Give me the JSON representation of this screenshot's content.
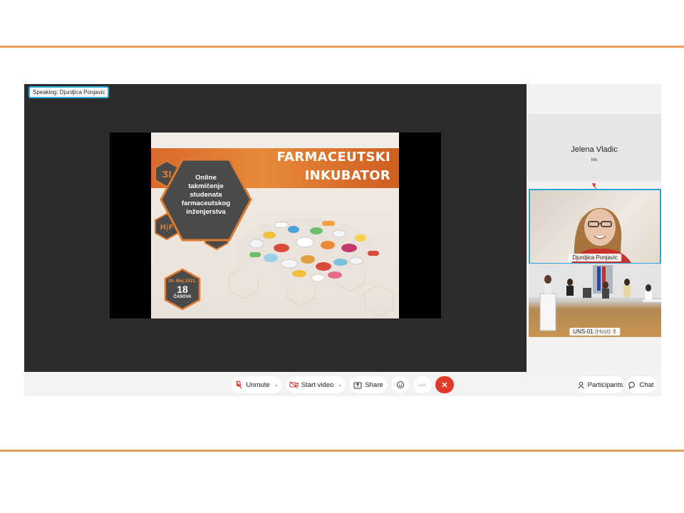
{
  "app": {
    "speaking_label": "Speaking: Djurdjica Ponjavic",
    "slide": {
      "title_line1": "FARMACEUTSKI",
      "title_line2": "INKUBATOR",
      "hexagon_text": [
        "Online",
        "takmičenje",
        "studenata",
        "farmaceutskog",
        "inženjerstva"
      ],
      "date_line": "26. Maj 2021.",
      "date_big": "18",
      "date_unit": "ČASOVA"
    },
    "participants": {
      "self": {
        "name": "Jelena Vladic",
        "tag": "Me"
      },
      "speaker": {
        "name": "Djurdjica Ponjavic"
      },
      "room": {
        "name": "UNS-01",
        "host": "(Host)"
      }
    },
    "toolbar": {
      "unmute": "Unmute",
      "start_video": "Start video",
      "share": "Share",
      "participants": "Participants",
      "chat": "Chat"
    },
    "colors": {
      "accent_rule": "#e5a060",
      "active_border": "#2ba7d6",
      "leave_red": "#e03b2a",
      "mute_red": "#d9342b",
      "slide_orange": "#e07a30"
    },
    "icons": [
      "microphone-muted-icon",
      "video-off-icon",
      "share-screen-icon",
      "reactions-icon",
      "more-icon",
      "close-icon",
      "participants-icon",
      "chat-icon"
    ]
  }
}
